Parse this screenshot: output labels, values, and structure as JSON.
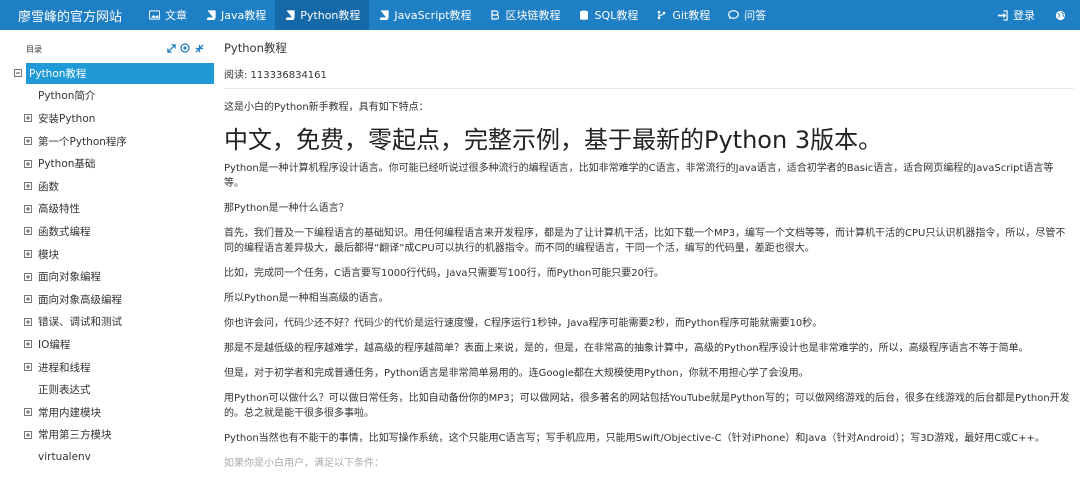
{
  "navbar": {
    "brand": "廖雪峰的官方网站",
    "items": [
      {
        "label": "文章",
        "icon": "image-icon",
        "active": false
      },
      {
        "label": "Java教程",
        "icon": "book-icon",
        "active": false
      },
      {
        "label": "Python教程",
        "icon": "book-icon",
        "active": true
      },
      {
        "label": "JavaScript教程",
        "icon": "book-icon",
        "active": false
      },
      {
        "label": "区块链教程",
        "icon": "bitcoin-icon",
        "active": false
      },
      {
        "label": "SQL教程",
        "icon": "database-icon",
        "active": false
      },
      {
        "label": "Git教程",
        "icon": "git-icon",
        "active": false
      },
      {
        "label": "问答",
        "icon": "chat-icon",
        "active": false
      }
    ],
    "login_label": "登录"
  },
  "sidebar": {
    "header": "目录",
    "tree": [
      {
        "label": "Python教程",
        "toggle": "minus",
        "level": "root"
      },
      {
        "label": "Python简介",
        "toggle": "none"
      },
      {
        "label": "安装Python",
        "toggle": "plus"
      },
      {
        "label": "第一个Python程序",
        "toggle": "plus"
      },
      {
        "label": "Python基础",
        "toggle": "plus"
      },
      {
        "label": "函数",
        "toggle": "plus"
      },
      {
        "label": "高级特性",
        "toggle": "plus"
      },
      {
        "label": "函数式编程",
        "toggle": "plus"
      },
      {
        "label": "模块",
        "toggle": "plus"
      },
      {
        "label": "面向对象编程",
        "toggle": "plus"
      },
      {
        "label": "面向对象高级编程",
        "toggle": "plus"
      },
      {
        "label": "错误、调试和测试",
        "toggle": "plus"
      },
      {
        "label": "IO编程",
        "toggle": "plus"
      },
      {
        "label": "进程和线程",
        "toggle": "plus"
      },
      {
        "label": "正则表达式",
        "toggle": "none"
      },
      {
        "label": "常用内建模块",
        "toggle": "plus"
      },
      {
        "label": "常用第三方模块",
        "toggle": "plus"
      },
      {
        "label": "virtualenv",
        "toggle": "none"
      }
    ]
  },
  "main": {
    "title": "Python教程",
    "read_count": "阅读: 113336834161",
    "intro": "这是小白的Python新手教程，具有如下特点：",
    "headline": "中文，免费，零起点，完整示例，基于最新的Python 3版本。",
    "paragraphs": [
      "Python是一种计算机程序设计语言。你可能已经听说过很多种流行的编程语言，比如非常难学的C语言，非常流行的Java语言，适合初学者的Basic语言，适合网页编程的JavaScript语言等等。",
      "那Python是一种什么语言？",
      "首先，我们普及一下编程语言的基础知识。用任何编程语言来开发程序，都是为了让计算机干活，比如下载一个MP3，编写一个文档等等，而计算机干活的CPU只认识机器指令，所以，尽管不同的编程语言差异极大，最后都得“翻译”成CPU可以执行的机器指令。而不同的编程语言，干同一个活，编写的代码量，差距也很大。",
      "比如，完成同一个任务，C语言要写1000行代码，Java只需要写100行，而Python可能只要20行。",
      "所以Python是一种相当高级的语言。",
      "你也许会问，代码少还不好？代码少的代价是运行速度慢，C程序运行1秒钟，Java程序可能需要2秒，而Python程序可能就需要10秒。",
      "那是不是越低级的程序越难学，越高级的程序越简单？表面上来说，是的，但是，在非常高的抽象计算中，高级的Python程序设计也是非常难学的，所以，高级程序语言不等于简单。",
      "但是，对于初学者和完成普通任务，Python语言是非常简单易用的。连Google都在大规模使用Python，你就不用担心学了会没用。",
      "用Python可以做什么？可以做日常任务，比如自动备份你的MP3；可以做网站，很多著名的网站包括YouTube就是Python写的；可以做网络游戏的后台，很多在线游戏的后台都是Python开发的。总之就是能干很多很多事啦。",
      "Python当然也有不能干的事情，比如写操作系统，这个只能用C语言写；写手机应用，只能用Swift/Objective-C（针对iPhone）和Java（针对Android）；写3D游戏，最好用C或C++。",
      "如果你是小白用户，满足以下条件："
    ]
  },
  "colors": {
    "navbar_bg": "#1f7fc5",
    "navbar_active": "#1669a8",
    "tree_selected": "#1f9ad6"
  }
}
